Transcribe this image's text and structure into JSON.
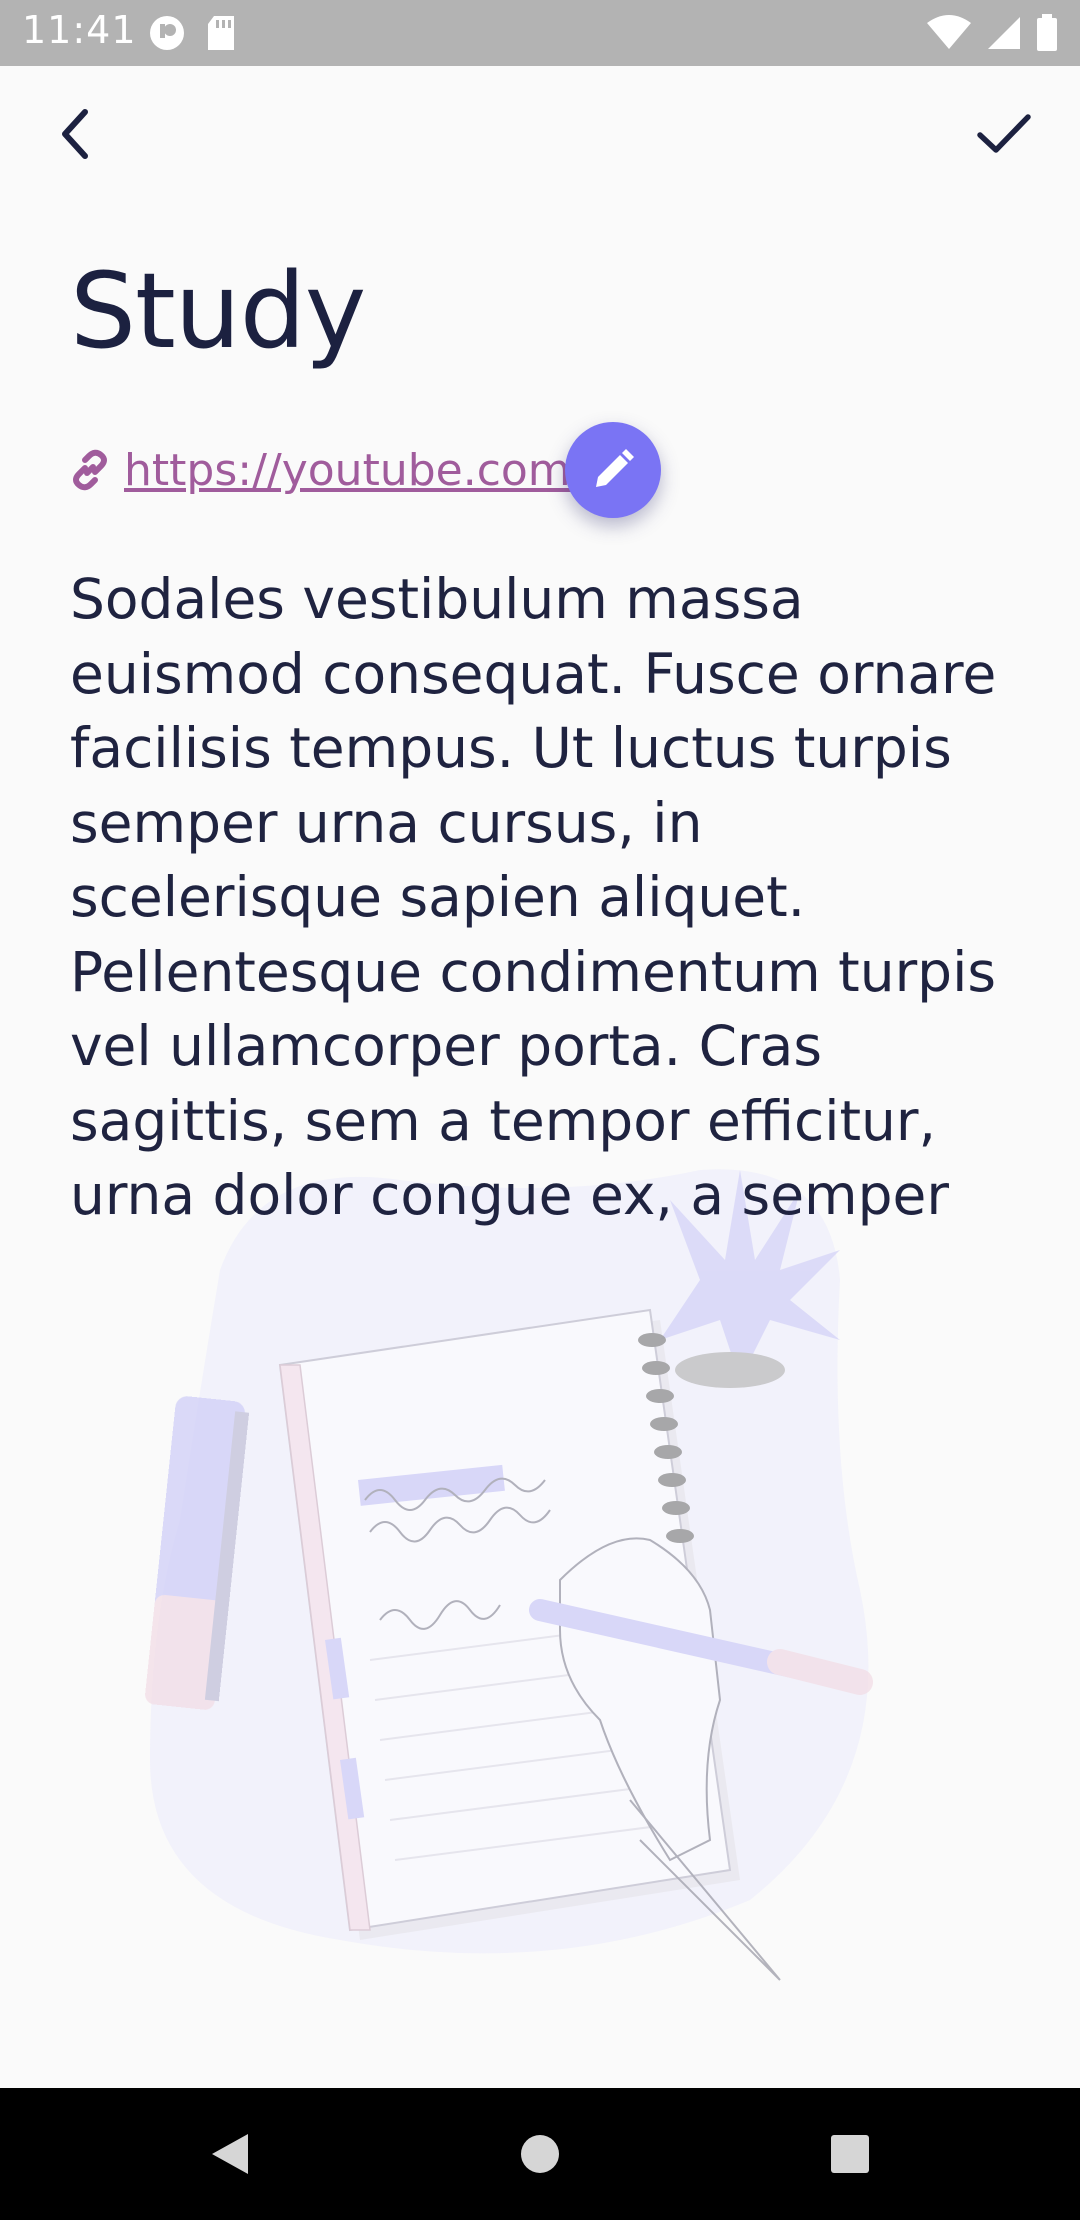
{
  "status_bar": {
    "time": "11:41",
    "icons": [
      "sync-icon",
      "sd-card-icon",
      "wifi-icon",
      "signal-icon",
      "battery-icon"
    ]
  },
  "app_bar": {
    "back_icon": "chevron-left-icon",
    "done_icon": "checkmark-icon"
  },
  "note": {
    "title": "Study",
    "link": "https://youtube.com",
    "body": "Sodales vestibulum massa euismod consequat. Fusce ornare facilisis tempus. Ut luctus turpis semper urna cursus, in scelerisque sapien aliquet. Pellentesque condimentum turpis vel ullamcorper porta. Cras sagittis, sem a tempor efficitur, urna dolor congue ex, a semper"
  },
  "colors": {
    "accent": "#7a74f4",
    "link": "#a05c9c",
    "text": "#1f2340",
    "background": "#fafafa"
  },
  "nav_bar": {
    "icons": [
      "back-triangle-icon",
      "home-circle-icon",
      "recents-square-icon"
    ]
  }
}
